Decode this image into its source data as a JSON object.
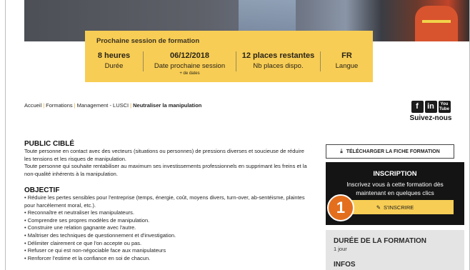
{
  "session": {
    "title": "Prochaine session de formation",
    "columns": [
      {
        "value": "8 heures",
        "label": "Durée"
      },
      {
        "value": "06/12/2018",
        "label": "Date prochaine session",
        "extra": "+ de dates"
      },
      {
        "value": "12 places restantes",
        "label": "Nb places dispo."
      },
      {
        "value": "FR",
        "label": "Langue"
      }
    ]
  },
  "breadcrumb": {
    "items": [
      "Accueil",
      "Formations",
      "Management - LUSCI"
    ],
    "current": "Neutraliser la manipulation"
  },
  "social": {
    "icons": [
      "f",
      "in",
      "You Tube"
    ],
    "follow_label": "Suivez-nous"
  },
  "public": {
    "heading": "PUBLIC CIBLÉ",
    "lines": [
      "Toute personne en contact avec des vecteurs (situations ou personnes) de pressions diverses et soucieuse de réduire les tensions et les risques de manipulation.",
      "Toute personne qui souhaite rentabiliser au maximum ses investissements professionnels en supprimant les freins et la non-qualité inhérents à la manipulation."
    ]
  },
  "objectif": {
    "heading": "OBJECTIF",
    "items": [
      "• Réduire les pertes sensibles pour l'entreprise (temps, énergie, coût, moyens divers, turn-over, ab-sentéisme, plaintes pour harcèlement moral, etc.).",
      "• Reconnaître et neutraliser les manipulateurs.",
      "• Comprendre ses propres modèles de manipulation.",
      "• Construire une relation gagnante avec l'autre.",
      "• Maîtriser des techniques de questionnement et d'investigation.",
      "• Délimiter clairement ce que l'on accepte ou pas.",
      "• Refuser ce qui est non-négociable face aux manipulateurs",
      "• Renforcer l'estime et la confiance en soi de chacun."
    ]
  },
  "download": {
    "icon": "download-icon",
    "label": "TÉLÉCHARGER LA FICHE FORMATION"
  },
  "inscription": {
    "title": "INSCRIPTION",
    "text": "Inscrivez vous à cette formation dès maintenant en quelques clics",
    "button_label": "S'INSCRIRE",
    "button_icon": "pencil-icon"
  },
  "badge": {
    "number": "1",
    "color": "#e36f1e"
  },
  "duree": {
    "title": "DURÉE DE LA FORMATION",
    "value": "1 jour"
  },
  "infos": {
    "title": "INFOS"
  },
  "colors": {
    "accent": "#f7cd55",
    "dark": "#141414",
    "sidebar_bg": "#e4e4e4"
  }
}
